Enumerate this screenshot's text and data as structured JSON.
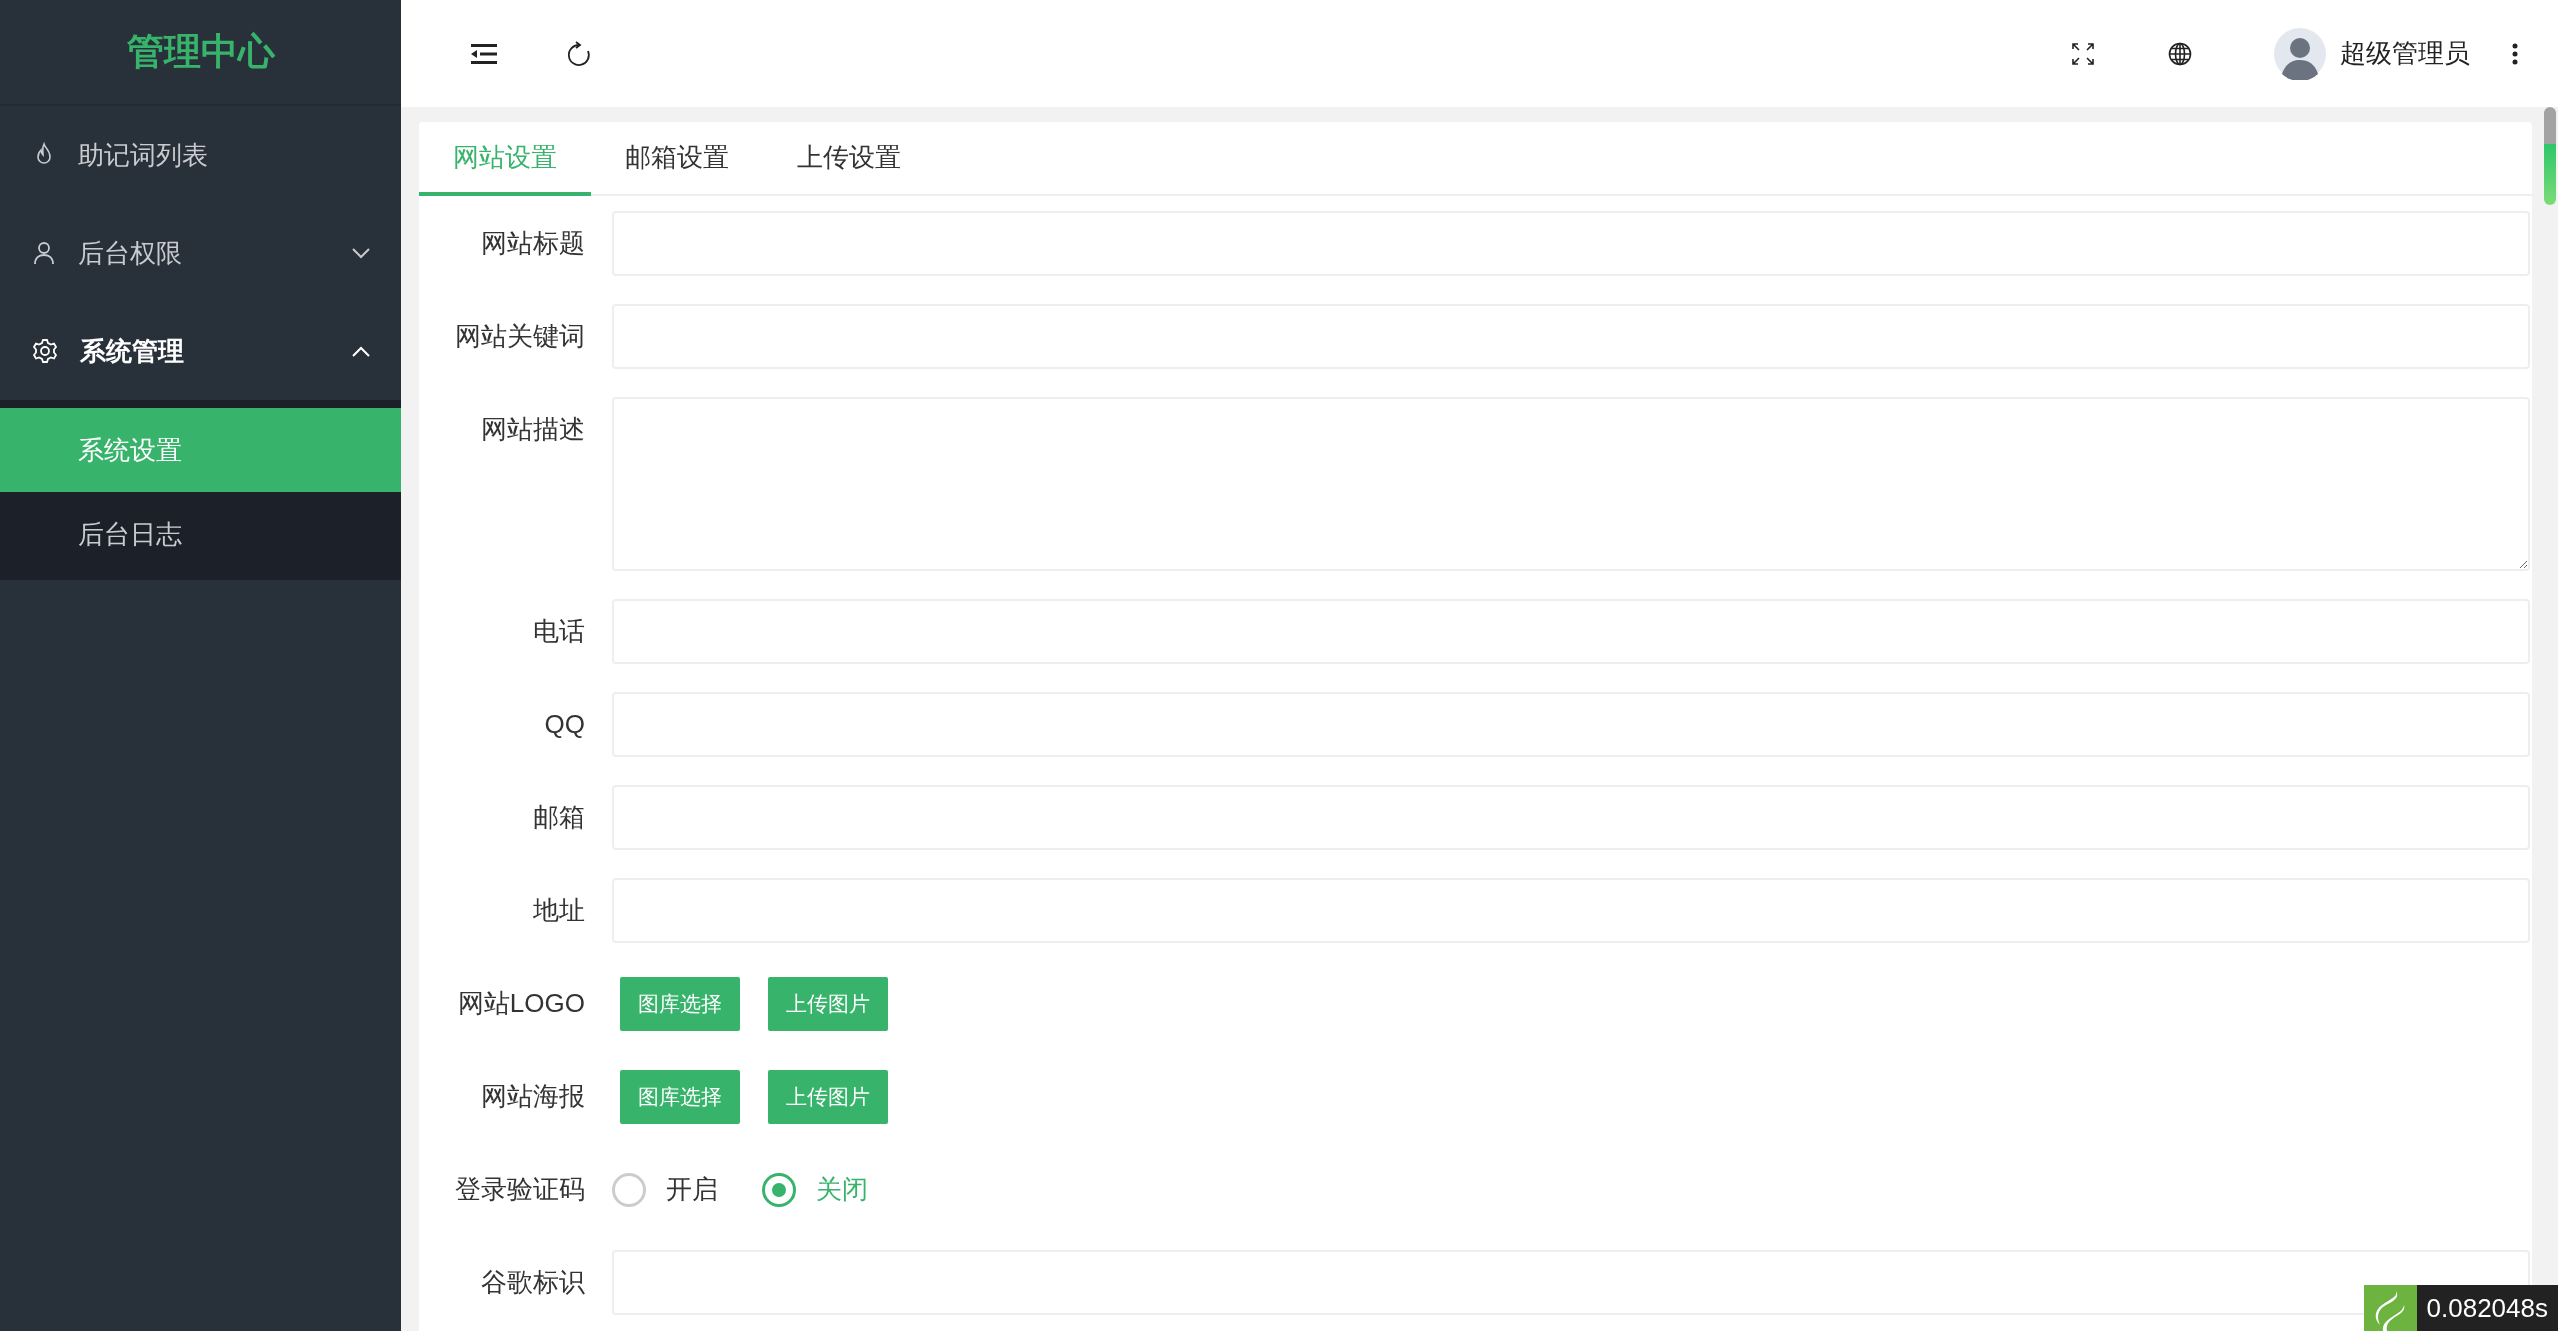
{
  "sidebar": {
    "title": "管理中心",
    "items": [
      {
        "label": "助记词列表",
        "kind": "link"
      },
      {
        "label": "后台权限",
        "kind": "group",
        "expanded": false
      },
      {
        "label": "系统管理",
        "kind": "group",
        "expanded": true,
        "children": [
          {
            "label": "系统设置",
            "selected": true
          },
          {
            "label": "后台日志",
            "selected": false
          }
        ]
      }
    ]
  },
  "header": {
    "user_name": "超级管理员"
  },
  "tabs": [
    {
      "label": "网站设置",
      "selected": true
    },
    {
      "label": "邮箱设置",
      "selected": false
    },
    {
      "label": "上传设置",
      "selected": false
    }
  ],
  "form": {
    "fields": [
      {
        "kind": "text",
        "label": "网站标题"
      },
      {
        "kind": "text",
        "label": "网站关键词"
      },
      {
        "kind": "textarea",
        "label": "网站描述"
      },
      {
        "kind": "text",
        "label": "电话"
      },
      {
        "kind": "text",
        "label": "QQ"
      },
      {
        "kind": "text",
        "label": "邮箱"
      },
      {
        "kind": "text",
        "label": "地址"
      },
      {
        "kind": "buttons",
        "label": "网站LOGO",
        "buttons": [
          "图库选择",
          "上传图片"
        ]
      },
      {
        "kind": "buttons",
        "label": "网站海报",
        "buttons": [
          "图库选择",
          "上传图片"
        ]
      },
      {
        "kind": "radio",
        "label": "登录验证码",
        "options": [
          {
            "label": "开启",
            "selected": false
          },
          {
            "label": "关闭",
            "selected": true
          }
        ]
      },
      {
        "kind": "text",
        "label": "谷歌标识"
      }
    ]
  },
  "debug_badge": {
    "time": "0.082048s"
  }
}
